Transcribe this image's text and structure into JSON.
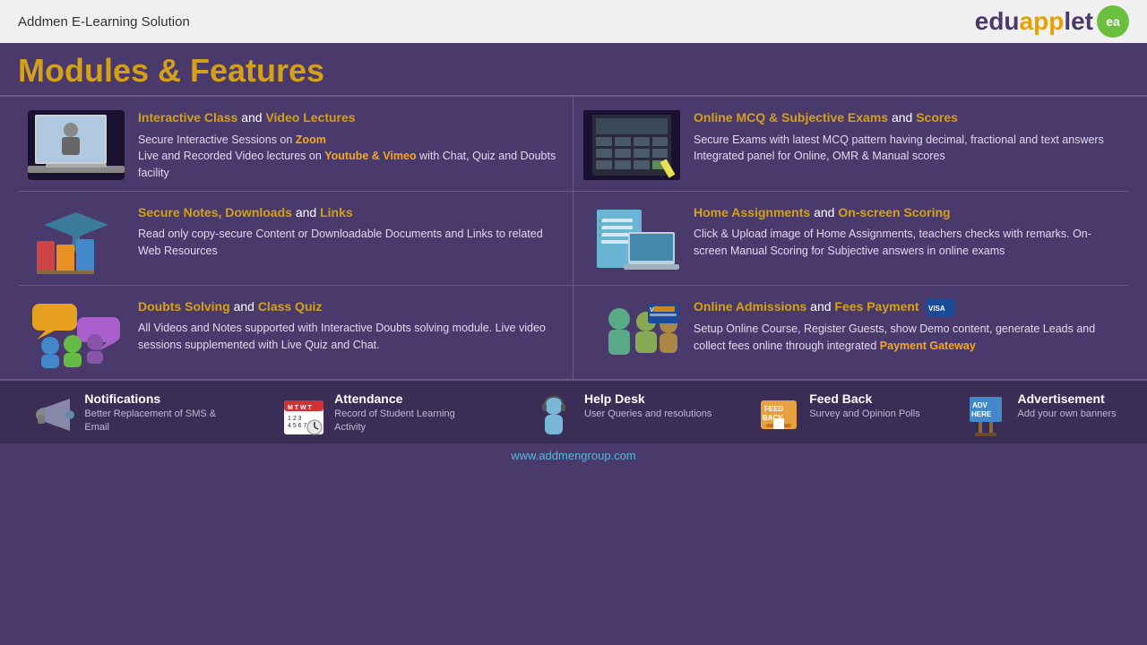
{
  "topBar": {
    "title": "Addmen E-Learning Solution",
    "logo": "eduapplet",
    "logoBadge": "ea"
  },
  "pageTitle": "Modules & Features",
  "features": [
    {
      "id": "interactive-class",
      "title_part1": "Interactive Class",
      "title_and": " and ",
      "title_part2": "Video Lectures",
      "description": "Secure Interactive Sessions on Zoom\nLive and Recorded Video lectures on Youtube & Vimeo with Chat, Quiz and Doubts facility",
      "zoom": "Zoom",
      "youtube_vimeo": "Youtube & Vimeo"
    },
    {
      "id": "mcq-exams",
      "title_part1": "Online MCQ & Subjective Exams",
      "title_and": " and ",
      "title_part2": "Scores",
      "description": "Secure Exams with latest MCQ pattern having decimal, fractional and text answers\nIntegrated panel for Online, OMR & Manual scores"
    },
    {
      "id": "secure-notes",
      "title_part1": "Secure Notes, Downloads",
      "title_and": " and ",
      "title_part2": "Links",
      "description": "Read only copy-secure Content or Downloadable Documents and Links to related Web Resources"
    },
    {
      "id": "home-assignments",
      "title_part1": "Home Assignments",
      "title_and": " and ",
      "title_part2": "On-screen Scoring",
      "description": "Click & Upload image of Home Assignments, teachers checks with remarks. On-screen Manual Scoring for Subjective answers in online exams"
    },
    {
      "id": "doubts-solving",
      "title_part1": "Doubts Solving",
      "title_and": " and ",
      "title_part2": "Class Quiz",
      "description": "All Videos and Notes supported with Interactive Doubts solving module. Live video sessions supplemented with Live Quiz and Chat."
    },
    {
      "id": "online-admissions",
      "title_part1": "Online Admissions",
      "title_and": " and ",
      "title_part2": "Fees Payment",
      "description": "Setup Online Course, Register Guests, show Demo content, generate Leads and collect fees online through integrated Payment Gateway",
      "gateway": "Payment Gateway"
    }
  ],
  "bottomItems": [
    {
      "id": "notifications",
      "title": "Notifications",
      "description": "Better Replacement of SMS & Email"
    },
    {
      "id": "attendance",
      "title": "Attendance",
      "description": "Record of Student Learning Activity"
    },
    {
      "id": "helpdesk",
      "title": "Help Desk",
      "description": "User Queries and resolutions"
    },
    {
      "id": "feedback",
      "title": "Feed Back",
      "description": "Survey and Opinion Polls"
    },
    {
      "id": "advertisement",
      "title": "Advertisement",
      "description": "Add your own banners"
    }
  ],
  "footer": {
    "url": "www.addmengroup.com"
  }
}
